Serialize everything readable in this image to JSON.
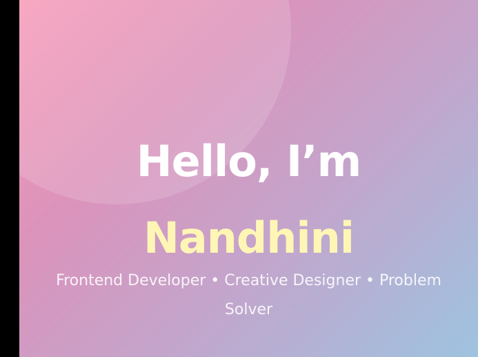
{
  "hero": {
    "greeting": "Hello, I’m",
    "name": "Nandhini",
    "tagline": "Frontend Developer • Creative Designer • Problem Solver"
  },
  "colors": {
    "gradient_start": "#f79ab7",
    "gradient_end": "#9ec3e0",
    "greeting_text": "#ffffff",
    "name_text": "#fff6b6",
    "frame_edge": "#000000"
  }
}
